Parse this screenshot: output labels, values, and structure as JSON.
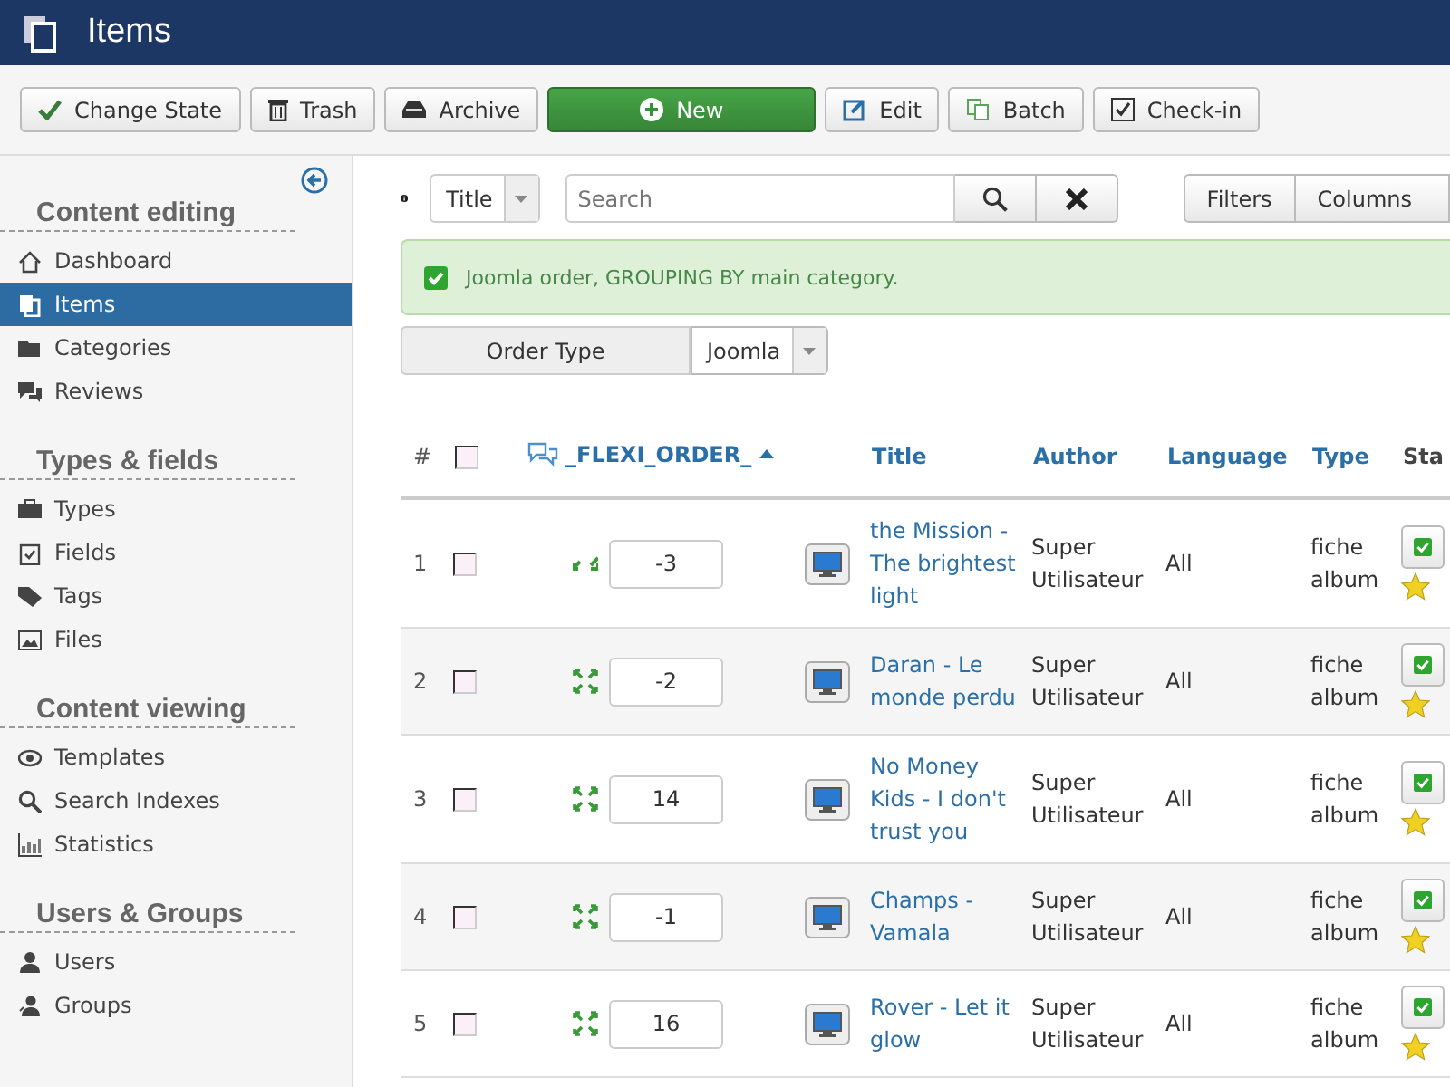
{
  "header": {
    "title": "Items"
  },
  "toolbar": [
    {
      "label": "Change State",
      "kind": "check"
    },
    {
      "label": "Trash",
      "kind": "trash"
    },
    {
      "label": "Archive",
      "kind": "archive"
    },
    {
      "label": "New",
      "kind": "new"
    },
    {
      "label": "Edit",
      "kind": "edit"
    },
    {
      "label": "Batch",
      "kind": "batch"
    },
    {
      "label": "Check-in",
      "kind": "checkin"
    }
  ],
  "sidebar": {
    "sections": [
      {
        "title": "Content editing",
        "items": [
          {
            "label": "Dashboard",
            "selected": false
          },
          {
            "label": "Items",
            "selected": true
          },
          {
            "label": "Categories",
            "selected": false
          },
          {
            "label": "Reviews",
            "selected": false
          }
        ]
      },
      {
        "title": "Types & fields",
        "items": [
          {
            "label": "Types",
            "selected": false
          },
          {
            "label": "Fields",
            "selected": false
          },
          {
            "label": "Tags",
            "selected": false
          },
          {
            "label": "Files",
            "selected": false
          }
        ]
      },
      {
        "title": "Content viewing",
        "items": [
          {
            "label": "Templates",
            "selected": false
          },
          {
            "label": "Search Indexes",
            "selected": false
          },
          {
            "label": "Statistics",
            "selected": false
          }
        ]
      },
      {
        "title": "Users & Groups",
        "items": [
          {
            "label": "Users",
            "selected": false
          },
          {
            "label": "Groups",
            "selected": false
          }
        ]
      }
    ]
  },
  "filter_bar": {
    "search_in": "Title",
    "search": {
      "placeholder": "Search"
    },
    "buttons": [
      "Filters",
      "Columns"
    ]
  },
  "alert": {
    "text": "Joomla order, GROUPING BY main category."
  },
  "order_type": {
    "label": "Order Type",
    "value": "Joomla"
  },
  "table": {
    "select_all": {
      "checked": false
    },
    "columns": [
      "#",
      "_FLEXI_ORDER_",
      "Title",
      "Author",
      "Language",
      "Type",
      "Sta"
    ],
    "rows": [
      {
        "number": "1",
        "selected": false,
        "kind": "down",
        "order": "-3",
        "title": "the Mission - The brightest light",
        "author": "Super Utilisateur",
        "language": "All",
        "type": "fiche album",
        "published": true,
        "featured": true
      },
      {
        "number": "2",
        "selected": false,
        "kind": "both",
        "order": "-2",
        "title": "Daran - Le monde perdu",
        "author": "Super Utilisateur",
        "language": "All",
        "type": "fiche album",
        "published": true,
        "featured": true
      },
      {
        "number": "3",
        "selected": false,
        "kind": "both",
        "order": "14",
        "title": "No Money Kids - I don't trust you",
        "author": "Super Utilisateur",
        "language": "All",
        "type": "fiche album",
        "published": true,
        "featured": true
      },
      {
        "number": "4",
        "selected": false,
        "kind": "both",
        "order": "-1",
        "title": "Champs - Vamala",
        "author": "Super Utilisateur",
        "language": "All",
        "type": "fiche album",
        "published": true,
        "featured": true
      },
      {
        "number": "5",
        "selected": false,
        "kind": "both",
        "order": "16",
        "title": "Rover - Let it glow",
        "author": "Super Utilisateur",
        "language": "All",
        "type": "fiche album",
        "published": true,
        "featured": true
      }
    ]
  }
}
